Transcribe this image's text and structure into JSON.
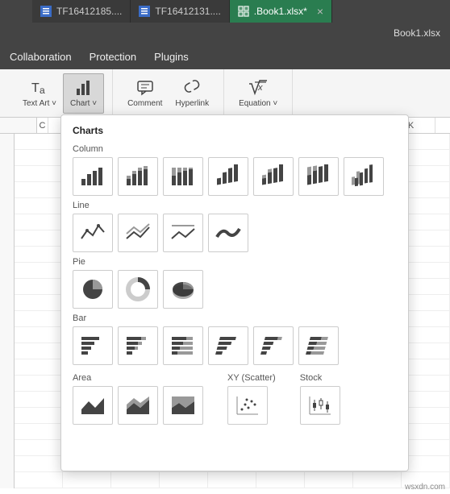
{
  "tabs": {
    "doc1": "TF16412185....",
    "doc2": "TF16412131....",
    "active": ".Book1.xlsx*"
  },
  "title": "Book1.xlsx",
  "menu": {
    "collab": "Collaboration",
    "protect": "Protection",
    "plugins": "Plugins"
  },
  "toolbar": {
    "textart": "Text Art",
    "chart": "Chart",
    "comment": "Comment",
    "hyperlink": "Hyperlink",
    "equation": "Equation"
  },
  "cols": [
    "C",
    "",
    "",
    "",
    "",
    "",
    "",
    "",
    "K"
  ],
  "charts": {
    "title": "Charts",
    "column": "Column",
    "line": "Line",
    "pie": "Pie",
    "bar": "Bar",
    "area": "Area",
    "scatter": "XY (Scatter)",
    "stock": "Stock"
  },
  "watermark": "wsxdn.com"
}
